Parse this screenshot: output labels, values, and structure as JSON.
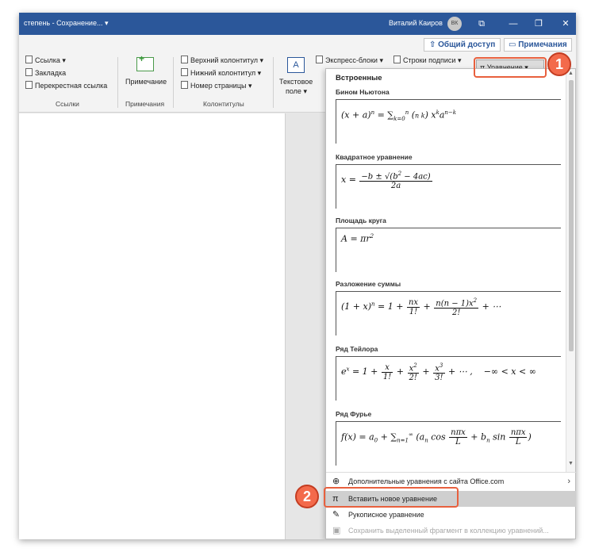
{
  "titlebar": {
    "doc_title": "степень - Сохранение... ▾",
    "user_name": "Виталий Каиров",
    "avatar_initials": "ВК",
    "buttons": [
      "⧉",
      "—",
      "❐",
      "✕"
    ]
  },
  "share_row": {
    "share_label": "⇧ Общий доступ",
    "notes_label": "▭ Примечания"
  },
  "ribbon": {
    "links": {
      "items": [
        "Ссылка ▾",
        "Закладка",
        "Перекрестная ссылка"
      ],
      "group_label": "Ссылки"
    },
    "comments": {
      "button_label": "Примечание",
      "group_label": "Примечания"
    },
    "header_footer": {
      "items": [
        "Верхний колонтитул ▾",
        "Нижний колонтитул ▾",
        "Номер страницы ▾"
      ],
      "group_label": "Колонтитулы"
    },
    "text": {
      "textbox_line1": "Текстовое",
      "textbox_line2": "поле ▾",
      "textbox_icon": "A",
      "quick_parts": "Экспресс-блоки ▾",
      "signature": "Строки подписи ▾",
      "equation": "π Уравнение ▾"
    }
  },
  "panel": {
    "section_head": "Встроенные",
    "equations": [
      {
        "title": "Бином Ньютона"
      },
      {
        "title": "Квадратное уравнение"
      },
      {
        "title": "Площадь круга"
      },
      {
        "title": "Разложение суммы"
      },
      {
        "title": "Ряд Тейлора"
      },
      {
        "title": "Ряд Фурье"
      }
    ],
    "menu": [
      {
        "label": "Дополнительные уравнения с сайта Office.com",
        "icon": "⊕"
      },
      {
        "label": "Вставить новое уравнение",
        "icon": "π"
      },
      {
        "label": "Рукописное уравнение",
        "icon": "✎"
      },
      {
        "label": "Сохранить выделенный фрагмент в коллекцию уравнений...",
        "icon": "▣"
      }
    ]
  },
  "callouts": [
    "1",
    "2"
  ]
}
